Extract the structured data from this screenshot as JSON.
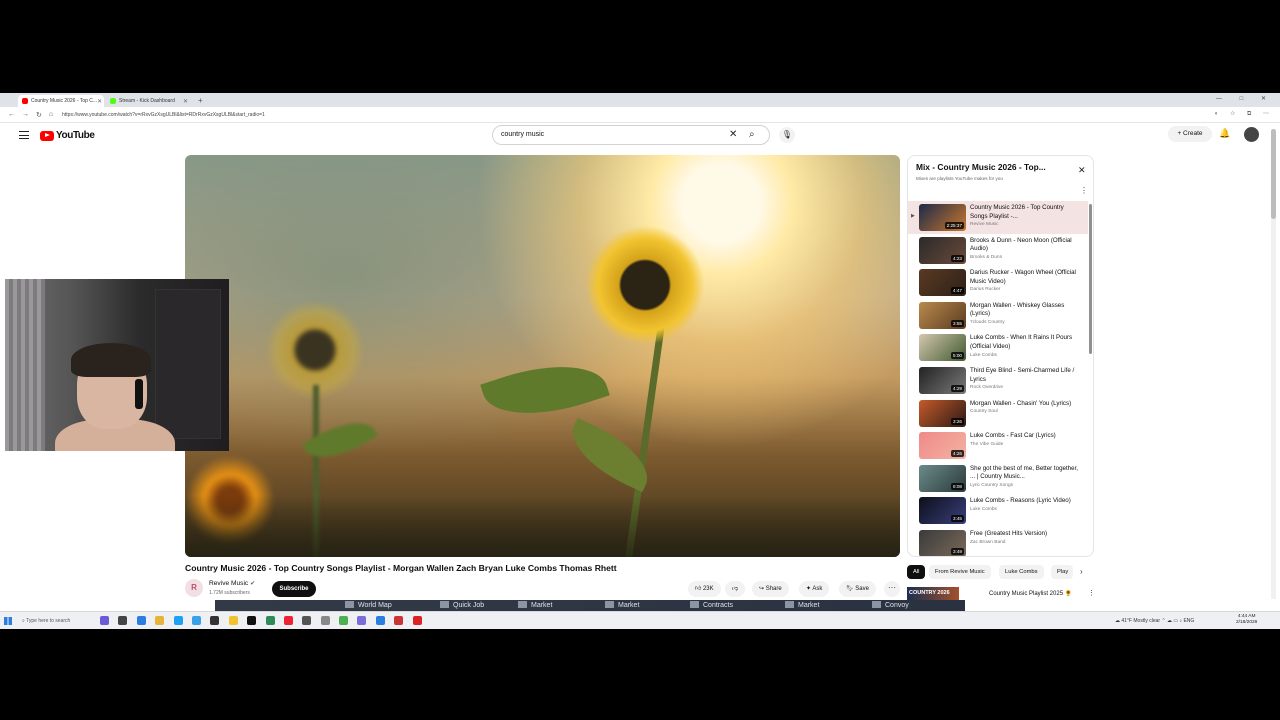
{
  "browser": {
    "tabs": [
      {
        "label": "Country Music 2026 - Top C...",
        "favicon_color": "#ff0000",
        "active": true
      },
      {
        "label": "Stream - Kick Dashboard",
        "favicon_color": "#53fc18",
        "active": false
      }
    ],
    "new_tab": "+",
    "url": "https://www.youtube.com/watch?v=rRxvGzXsgULBl&list=RDrRxvGzXsgULBl&start_radio=1",
    "window_controls": "— □ ✕"
  },
  "youtube": {
    "logo_text": "YouTube",
    "search": {
      "value": "country music"
    },
    "create_label": "+ Create",
    "brand_color": "#ff0000"
  },
  "video": {
    "title": "Country Music 2026 - Top Country Songs Playlist - Morgan Wallen Zach Bryan Luke Combs Thomas Rhett",
    "channel": "Revive Music",
    "channel_initial": "R",
    "verified": "✔",
    "subscribers": "1.72M subscribers",
    "subscribe_label": "Subscribe",
    "likes": "23K",
    "share_label": "Share",
    "ask_label": "Ask",
    "save_label": "Save",
    "more": "···"
  },
  "playlist": {
    "title": "Mix - Country Music 2026 - Top...",
    "subtitle": "Mixes are playlists YouTube makes for you",
    "items": [
      {
        "title": "Country Music 2026 - Top Country Songs Playlist -...",
        "channel": "Revive Music",
        "duration": "2:25:37",
        "current": true,
        "thumb": "linear-gradient(135deg,#1c2b4a,#c9762b)"
      },
      {
        "title": "Brooks & Dunn - Neon Moon (Official Audio)",
        "channel": "Brooks & Dunn",
        "duration": "4:23",
        "current": false,
        "thumb": "linear-gradient(135deg,#2a2a2a,#6b4a3a)"
      },
      {
        "title": "Darius Rucker - Wagon Wheel (Official Music Video)",
        "channel": "Darius Rucker",
        "duration": "4:47",
        "current": false,
        "thumb": "linear-gradient(135deg,#5a3a22,#2d2118)"
      },
      {
        "title": "Morgan Wallen - Whiskey Glasses (Lyrics)",
        "channel": "7clouds Country",
        "duration": "3:55",
        "current": false,
        "thumb": "linear-gradient(135deg,#b98a4d,#5b3b21)"
      },
      {
        "title": "Luke Combs - When It Rains It Pours (Official Video)",
        "channel": "Luke Combs",
        "duration": "5:00",
        "current": false,
        "thumb": "linear-gradient(135deg,#d5c7ae,#3f5a30)"
      },
      {
        "title": "Third Eye Blind - Semi-Charmed Life / Lyrics",
        "channel": "Rock Overdrive",
        "duration": "4:29",
        "current": false,
        "thumb": "linear-gradient(135deg,#222,#7a7a7a)"
      },
      {
        "title": "Morgan Wallen - Chasin' You (Lyrics)",
        "channel": "Country Soul",
        "duration": "3:26",
        "current": false,
        "thumb": "linear-gradient(135deg,#c55a2b,#2b1a14)"
      },
      {
        "title": "Luke Combs - Fast Car (Lyrics)",
        "channel": "The Vibe Guide",
        "duration": "4:26",
        "current": false,
        "thumb": "linear-gradient(135deg,#f08a8a,#f3b2a0)"
      },
      {
        "title": "She got the best of me, Better together, ... | Country Music...",
        "channel": "Lyric Country Songs",
        "duration": "8:08",
        "current": false,
        "thumb": "linear-gradient(135deg,#6c8a8a,#2a3a3a)"
      },
      {
        "title": "Luke Combs - Reasons (Lyric Video)",
        "channel": "Luke Combs",
        "duration": "3:45",
        "current": false,
        "thumb": "linear-gradient(135deg,#0d0f1c,#3a3f7a)"
      },
      {
        "title": "Free (Greatest Hits Version)",
        "channel": "Zac Brown Band",
        "duration": "3:49",
        "current": false,
        "thumb": "linear-gradient(135deg,#3a3a3a,#7a6a5a)"
      }
    ]
  },
  "chips": [
    "All",
    "From Revive Music",
    "Luke Combs",
    "Play"
  ],
  "up_next": {
    "thumb_text": "COUNTRY 2026",
    "title": "Country Music Playlist 2025 🌻"
  },
  "game_overlay": [
    "World Map",
    "Quick Job",
    "Market",
    "Market",
    "Contracts",
    "Market",
    "Convoy"
  ],
  "taskbar": {
    "search_placeholder": "Type here to search",
    "icon_colors": [
      "#6b5bd6",
      "#444",
      "#2a7de1",
      "#e8b33a",
      "#1da1f2",
      "#3aa0e8",
      "#333",
      "#f2c12e",
      "#111",
      "#2e8b57",
      "#e23",
      "#555",
      "#888",
      "#4caf50",
      "#7a6cd9",
      "#2a7de1",
      "#c33",
      "#d22"
    ],
    "weather": "41°F  Mostly clear",
    "tray_text": "ENG",
    "time": "4:44 AM",
    "date": "2/18/2026"
  }
}
